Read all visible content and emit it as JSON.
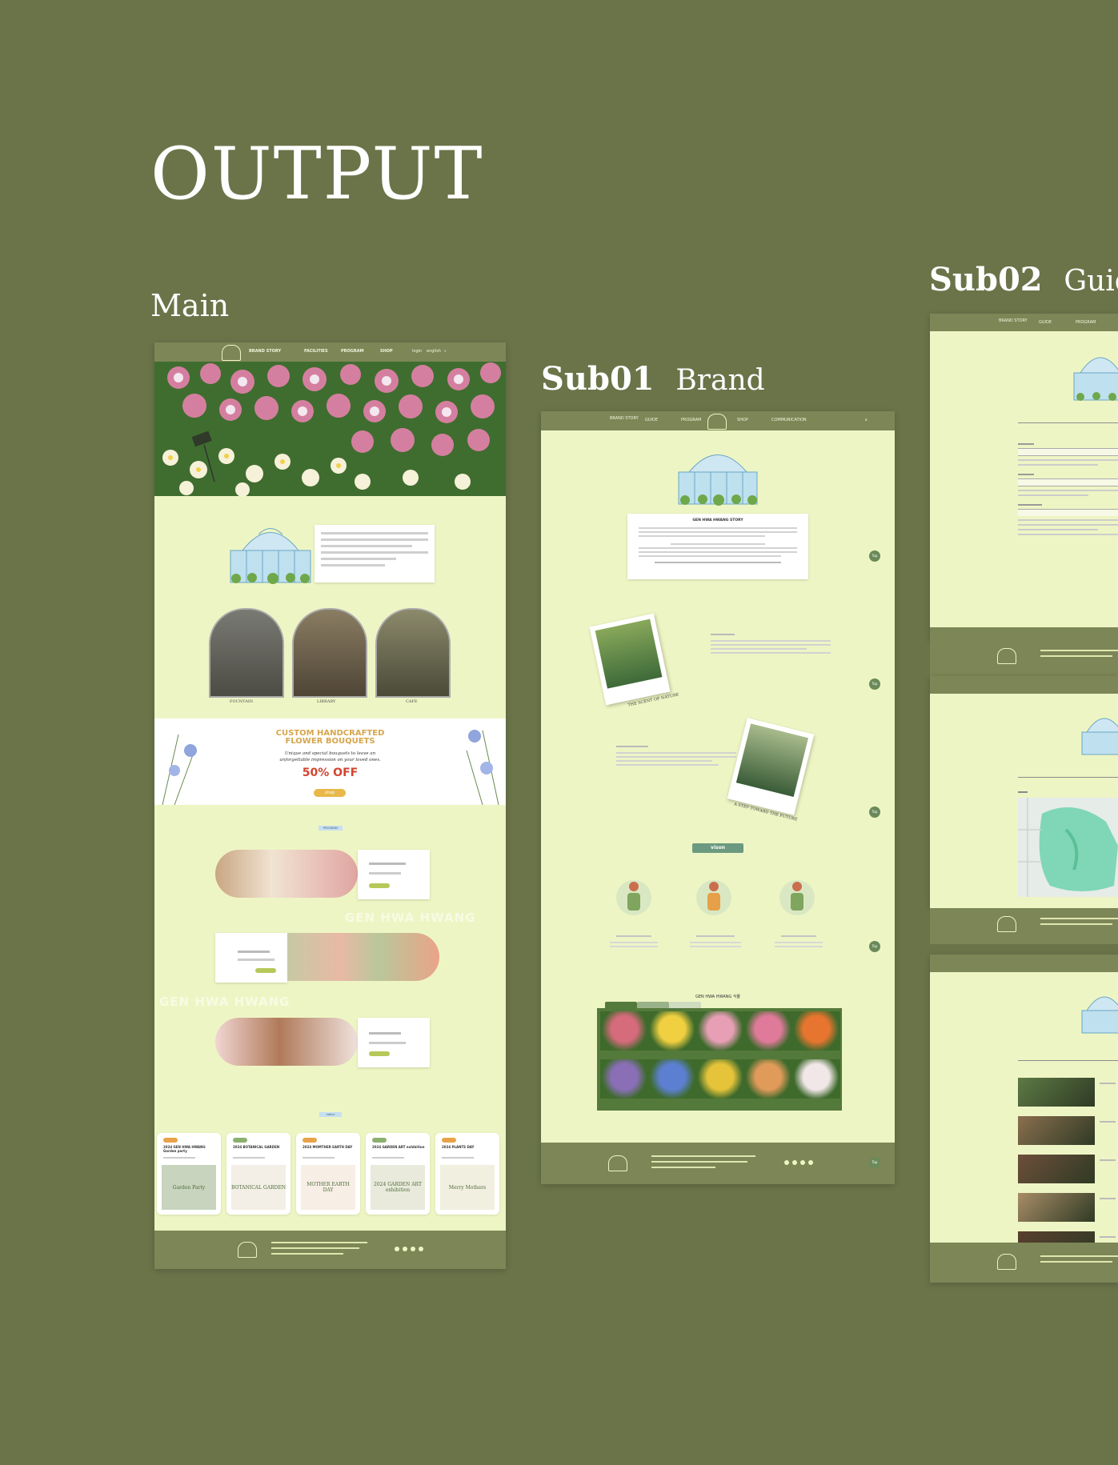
{
  "heading": "OUTPUT",
  "sections": {
    "main": "Main",
    "sub01_num": "Sub01",
    "sub01_name": "Brand",
    "sub02_num": "Sub02",
    "sub02_name": "Guid"
  },
  "main_page": {
    "nav": [
      "BRAND STORY",
      "FACILITIES",
      "PROGRAM",
      "SHOP"
    ],
    "util": [
      "login",
      "english"
    ],
    "facilities": [
      "FOUNTAIN",
      "LIBRARY",
      "CAFE"
    ],
    "promo_title_1": "CUSTOM HANDCRAFTED",
    "promo_title_2": "FLOWER BOUQUETS",
    "promo_sub_1": "Unique and special bouquets to leave an",
    "promo_sub_2": "unforgettable impression on your loved ones.",
    "promo_discount": "50% OFF",
    "promo_btn": "shop",
    "program_tag": "PROGRAM",
    "watermark": "GEN HWA HWANG",
    "notice_tag": "notice",
    "notices": [
      {
        "title": "2024 GEN HWA HWANG Garden party",
        "tag_color": "#e8a24a",
        "poster": "Garden Party"
      },
      {
        "title": "2024 BOTANICAL GARDEN",
        "tag_color": "#8ab06e",
        "poster": "BOTANICAL GARDEN"
      },
      {
        "title": "2024 MOMTHER EARTH DAY",
        "tag_color": "#e8a24a",
        "poster": "MOTHER EARTH DAY"
      },
      {
        "title": "2024 GARDEN ART exhibition",
        "tag_color": "#8ab06e",
        "poster": "2024 GARDEN ART exhibition"
      },
      {
        "title": "2024 PLANTS DAY",
        "tag_color": "#e8a24a",
        "poster": "Merry Mothers"
      }
    ]
  },
  "sub01_page": {
    "nav": [
      "BRAND STORY",
      "GUIDE",
      "PROGRAM",
      "SHOP",
      "COMMUNICATION"
    ],
    "story_title": "GEN HWA HWANG STORY",
    "photo_caption_1": "THE SCENT OF NATURE",
    "photo_caption_2": "A STEP TOWARD THE FUTURE",
    "vision_label": "vison",
    "plants_title": "GEN HWA HWANG 식물",
    "top_label": "Top"
  },
  "sub02_page": {
    "nav": [
      "BRAND STORY",
      "GUIDE",
      "PROGRAM"
    ]
  },
  "colors": {
    "background": "#6b7449",
    "page": "#eef5c4",
    "nav": "#7d8656",
    "accent_orange": "#e8a24a",
    "accent_red": "#d2452f"
  }
}
